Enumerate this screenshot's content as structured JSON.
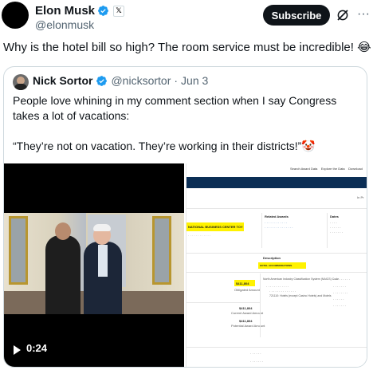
{
  "post": {
    "display_name": "Elon Musk",
    "handle": "@elonmusk",
    "x_badge": "𝕏",
    "subscribe_label": "Subscribe",
    "more_label": "···",
    "text": "Why is the hotel bill so high? The room service must be incredible! 😂"
  },
  "quote": {
    "display_name": "Nick Sortor",
    "handle": "@nicksortor",
    "separator": "·",
    "date": "Jun 3",
    "line1": "People love whining in my comment section when I say Congress takes a lot of vacations:",
    "line2": "“They’re not on vacation. They’re working in their districts!”🤡",
    "ellipsis": "...",
    "video_duration": "0:24"
  },
  "screenshot_doc": {
    "nav": [
      "Search Award Data",
      "Explore the Data",
      "Download"
    ],
    "page_label": "In Pr",
    "highlight_1": "NATIONAL BUSINESS CENTER TOY",
    "related_awards": "Related Awards",
    "dates": "Dates",
    "description": "Description",
    "highlight_2": "HOTEL ACCOMMODATIONS",
    "amount_1": "$411,804",
    "obligated": "Obligated Amount",
    "amount_2": "$411,804",
    "current_total": "Current Award Amount",
    "amount_3": "$411,804",
    "potential_total": "Potential Award Amount",
    "naics": "North American Industry Classification System (NAICS) Code",
    "hotels": "721110: Hotels (except Casino Hotels) and Motels"
  },
  "colors": {
    "verified_blue": "#1d9bf0",
    "subscribe_bg": "#0f1419",
    "doc_header": "#0b2e55",
    "highlight": "#fff200"
  }
}
